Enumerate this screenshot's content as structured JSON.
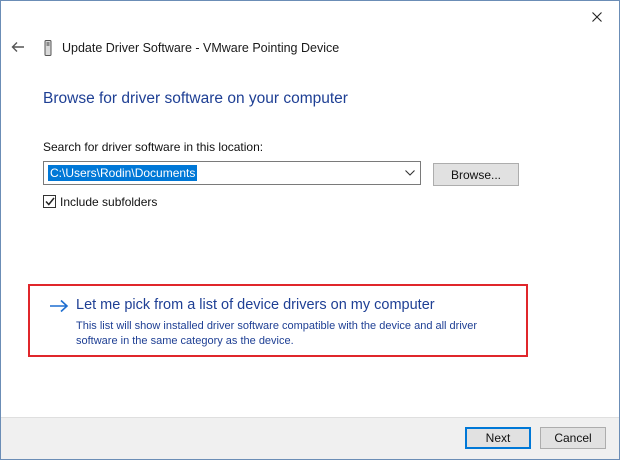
{
  "window": {
    "title": "Update Driver Software - VMware Pointing Device",
    "close_icon": "close-icon",
    "back_icon": "back-arrow-icon",
    "device_icon": "pointing-device-icon"
  },
  "main": {
    "heading": "Browse for driver software on your computer",
    "search_label": "Search for driver software in this location:",
    "path_value": "C:\\Users\\Rodin\\Documents",
    "browse_label": "Browse...",
    "include_subfolders_label": "Include subfolders",
    "include_subfolders_checked": true
  },
  "pick_option": {
    "title": "Let me pick from a list of device drivers on my computer",
    "description": "This list will show installed driver software compatible with the device and all driver software in the same category as the device.",
    "highlight_color": "#e0262b"
  },
  "footer": {
    "next_label": "Next",
    "cancel_label": "Cancel"
  },
  "colors": {
    "accent": "#0078d7",
    "heading": "#1e3f94"
  }
}
